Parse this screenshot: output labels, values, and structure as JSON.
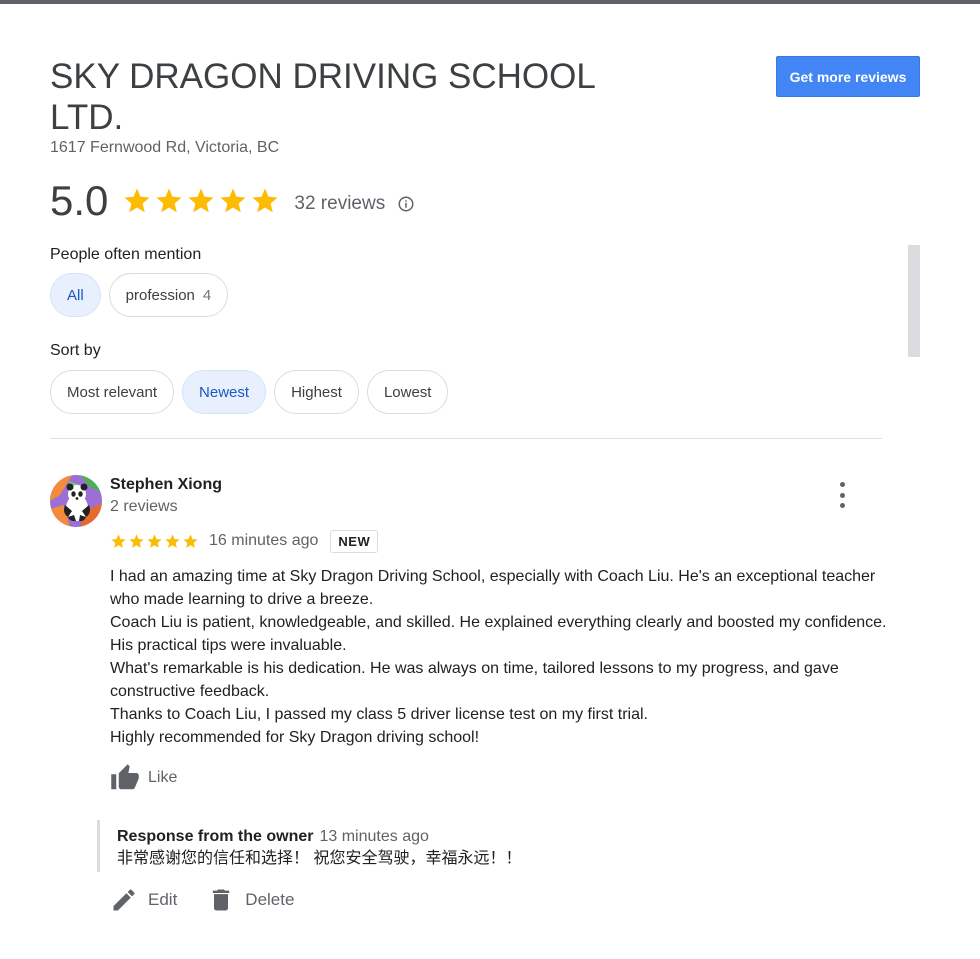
{
  "business": {
    "name": "SKY DRAGON DRIVING SCHOOL LTD.",
    "address": "1617 Fernwood Rd, Victoria, BC",
    "get_reviews_label": "Get more reviews",
    "rating": "5.0",
    "stars": 5,
    "review_count_label": "32 reviews",
    "info_icon": "info-icon",
    "star_color": "#fbbc04"
  },
  "mentions": {
    "label": "People often mention",
    "chips": [
      {
        "label": "All",
        "count": "",
        "selected": true
      },
      {
        "label": "profession",
        "count": "4",
        "selected": false
      }
    ]
  },
  "sort": {
    "label": "Sort by",
    "options": [
      {
        "label": "Most relevant",
        "selected": false
      },
      {
        "label": "Newest",
        "selected": true
      },
      {
        "label": "Highest",
        "selected": false
      },
      {
        "label": "Lowest",
        "selected": false
      }
    ]
  },
  "review": {
    "author": "Stephen Xiong",
    "author_meta": "2 reviews",
    "stars": 5,
    "time": "16 minutes ago",
    "badge": "NEW",
    "paragraphs": [
      "I had an amazing time at Sky Dragon Driving School, especially with Coach Liu. He's an exceptional teacher who made learning to drive a breeze.",
      "Coach Liu is patient, knowledgeable, and skilled. He explained everything clearly and boosted my confidence. His practical tips were invaluable.",
      "What's remarkable is his dedication. He was always on time, tailored lessons to my progress, and gave constructive feedback.",
      "Thanks to Coach Liu, I passed my class 5 driver license test on my first trial.",
      "Highly recommended for Sky Dragon driving school!"
    ],
    "like_label": "Like",
    "owner_response": {
      "label": "Response from the owner",
      "time": "13 minutes ago",
      "text": "非常感谢您的信任和选择！ 祝您安全驾驶，幸福永远！！"
    },
    "edit_label": "Edit",
    "delete_label": "Delete"
  },
  "colors": {
    "accent": "#4285f4",
    "chip_selected_bg": "#e8f0fe",
    "chip_selected_text": "#1a56c8"
  }
}
